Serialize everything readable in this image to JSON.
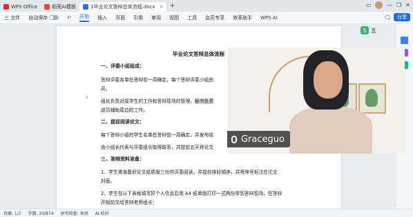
{
  "titlebar": {
    "tabs": [
      {
        "label": "WPS Office",
        "color": "#d9302a"
      },
      {
        "label": "稻壳AI模板",
        "color": "#e8452b"
      },
      {
        "label": "1毕业论文答辩总体流程.docx",
        "color": "#2e6cf0"
      }
    ],
    "new_tab": "+"
  },
  "ribbon": {
    "file": "三 文件",
    "autosave": "自动保存",
    "menus": [
      "开始",
      "插入",
      "页面",
      "引用",
      "审阅",
      "视图",
      "工具",
      "会员专享",
      "效率助手"
    ],
    "active_menu": "开始",
    "wps_ai": "WPS AI",
    "share": "分享"
  },
  "float_tool": {
    "label": "五"
  },
  "document": {
    "title": "毕业论文答辩总体流程",
    "sec1": "一、评委小组组成：",
    "p1a": "答辩评委名单在答辩前一周确定，每个答辩评委小组由",
    "p1b": "员。",
    "p2a": "组长负责对接学生的工作和答辩现场的管理，",
    "p2hl": "秘书负责",
    "p2b": "成员辅助周边的工作。",
    "sec2": "二、提前阅读论文：",
    "p3a": "每个答辩小组的学生名单在答辩前一周确定，并发布给",
    "p4a": "由小组长代表与评委组长取得联系，并提前五天将论文",
    "sec3": "三、答辩资料准备：",
    "p5a": "1、学生需准备好论文纸质版三份供评委阅读，并提前排好顺序，并将序号标注在论文",
    "p5b": "封面。",
    "p6a": "2、学生在以下表格填写好个人信息后用 A4 纸单面打印一式两份带到答辩现场，在答辩",
    "p6b": "开始前交给答辩老师组长："
  },
  "video": {
    "name": "Graceguo"
  },
  "statusbar": {
    "page": "页面: 1/2",
    "words": "字数: 20/874",
    "spell": "拼写检查: 关闭",
    "ai": "AI 校对"
  }
}
